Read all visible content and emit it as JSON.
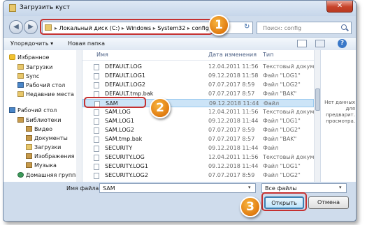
{
  "window": {
    "title": "Загрузить куст",
    "close_glyph": "✕"
  },
  "nav": {
    "back_glyph": "◀",
    "forward_glyph": "▶"
  },
  "address": {
    "segments": [
      "Локальный диск (C:)",
      "Windows",
      "System32",
      "config"
    ],
    "separator": "▸",
    "refresh_glyph": "↻"
  },
  "search": {
    "placeholder": "Поиск: config"
  },
  "toolbar": {
    "organize_label": "Упорядочить ▾",
    "new_folder_label": "Новая папка",
    "help_glyph": "?"
  },
  "sidebar": {
    "items": [
      {
        "label": "Избранное",
        "icon": "star-icon"
      },
      {
        "label": "Загрузки",
        "icon": "folder-icon"
      },
      {
        "label": "Sync",
        "icon": "folder-icon"
      },
      {
        "label": "Рабочий стол",
        "icon": "desktop-icon"
      },
      {
        "label": "Недавние места",
        "icon": "folder-icon"
      },
      {
        "label": "Рабочий стол",
        "icon": "desktop-icon"
      },
      {
        "label": "Библиотеки",
        "icon": "library-icon"
      },
      {
        "label": "Видео",
        "icon": "library-icon"
      },
      {
        "label": "Документы",
        "icon": "library-icon"
      },
      {
        "label": "Загрузки",
        "icon": "folder-icon"
      },
      {
        "label": "Изображения",
        "icon": "library-icon"
      },
      {
        "label": "Музыка",
        "icon": "library-icon"
      },
      {
        "label": "Домашняя группа",
        "icon": "homegroup-icon"
      }
    ]
  },
  "file_list": {
    "columns": [
      "Имя",
      "Дата изменения",
      "Тип"
    ],
    "rows": [
      {
        "name": "DEFAULT.LOG",
        "date": "12.04.2011 11:56",
        "type": "Текстовый докум..."
      },
      {
        "name": "DEFAULT.LOG1",
        "date": "09.12.2018 11:58",
        "type": "Файл \"LOG1\""
      },
      {
        "name": "DEFAULT.LOG2",
        "date": "07.07.2017 8:59",
        "type": "Файл \"LOG2\""
      },
      {
        "name": "DEFAULT.tmp.bak",
        "date": "07.07.2017 8:57",
        "type": "Файл \"BAK\""
      },
      {
        "name": "SAM",
        "date": "09.12.2018 11:44",
        "type": "Файл"
      },
      {
        "name": "SAM.LOG",
        "date": "12.04.2011 11:56",
        "type": "Текстовый докум..."
      },
      {
        "name": "SAM.LOG1",
        "date": "09.12.2018 11:44",
        "type": "Файл \"LOG1\""
      },
      {
        "name": "SAM.LOG2",
        "date": "07.07.2017 8:59",
        "type": "Файл \"LOG2\""
      },
      {
        "name": "SAM.tmp.bak",
        "date": "07.07.2017 8:57",
        "type": "Файл \"BAK\""
      },
      {
        "name": "SECURITY",
        "date": "09.12.2018 11:44",
        "type": "Файл"
      },
      {
        "name": "SECURITY.LOG",
        "date": "12.04.2011 11:56",
        "type": "Текстовый докум..."
      },
      {
        "name": "SECURITY.LOG1",
        "date": "09.12.2018 11:44",
        "type": "Файл \"LOG1\""
      },
      {
        "name": "SECURITY.LOG2",
        "date": "07.07.2017 8:59",
        "type": "Файл \"LOG2\""
      }
    ],
    "selected_name": "SAM"
  },
  "preview": {
    "text": "Нет данных для предварит. просмотра."
  },
  "bottom": {
    "filename_label": "Имя файла:",
    "filename_value": "SAM",
    "filetype_value": "Все файлы",
    "dropdown_glyph": "▾",
    "open_label": "Открыть",
    "cancel_label": "Отмена"
  },
  "callouts": [
    "1",
    "2",
    "3"
  ],
  "colors": {
    "highlight": "#c53030",
    "badge": "#e07b10",
    "selection": "#cce4f7"
  }
}
